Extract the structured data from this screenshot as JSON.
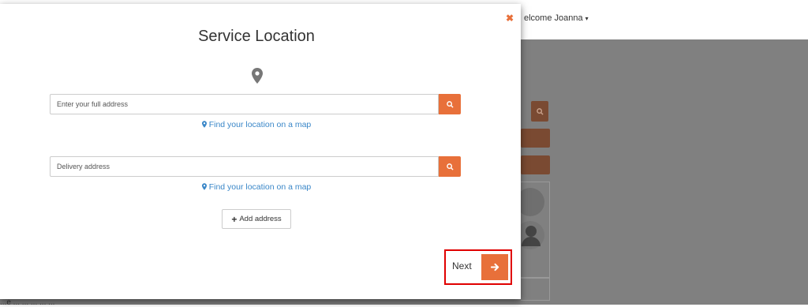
{
  "header": {
    "welcome_text": "elcome Joanna",
    "caret": "▾"
  },
  "background": {
    "footer_text": "...e ... ... ... ... ..."
  },
  "modal": {
    "close_symbol": "✖",
    "title": "Service Location",
    "address_input": {
      "placeholder": "Enter your full address",
      "value": ""
    },
    "map_link_1": "Find your location on a map",
    "delivery_input": {
      "placeholder": "Delivery address",
      "value": ""
    },
    "map_link_2": "Find your location on a map",
    "add_address_label": "Add address",
    "add_address_plus": "+",
    "next_label": "Next"
  },
  "colors": {
    "accent": "#e8703a",
    "link": "#3a87c8",
    "highlight": "#e00000",
    "overlay": "#808080"
  },
  "icons": {
    "pin": "map-marker-icon",
    "search": "search-icon",
    "arrow": "arrow-right-icon",
    "plus": "plus-icon",
    "close": "close-icon"
  }
}
